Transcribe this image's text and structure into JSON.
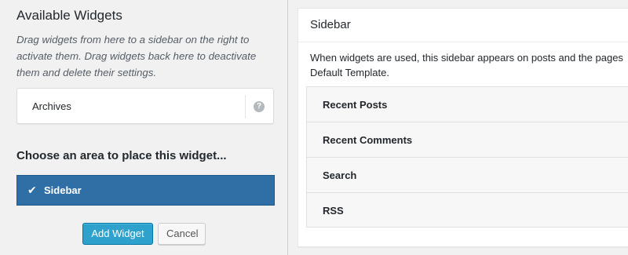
{
  "available_widgets": {
    "heading": "Available Widgets",
    "description": "Drag widgets from here to a sidebar on the right to activate them. Drag widgets back here to deactivate them and delete their settings."
  },
  "selected_widget": {
    "title": "Archives",
    "help_icon": "question-circle-icon",
    "help_glyph": "?"
  },
  "chooser": {
    "heading": "Choose an area to place this widget...",
    "areas": [
      {
        "label": "Sidebar",
        "selected": true,
        "check_glyph": "✔"
      }
    ],
    "add_button_label": "Add Widget",
    "cancel_button_label": "Cancel"
  },
  "sidebar": {
    "title": "Sidebar",
    "description_line1": "When widgets are used, this sidebar appears on posts and the pages",
    "description_line2": "Default Template.",
    "widgets": [
      {
        "label": "Recent Posts"
      },
      {
        "label": "Recent Comments"
      },
      {
        "label": "Search"
      },
      {
        "label": "RSS"
      }
    ]
  },
  "colors": {
    "selected_area_bg": "#2f6fa6",
    "primary_button_bg": "#2ea2cc",
    "page_bg": "#f1f1f1"
  }
}
